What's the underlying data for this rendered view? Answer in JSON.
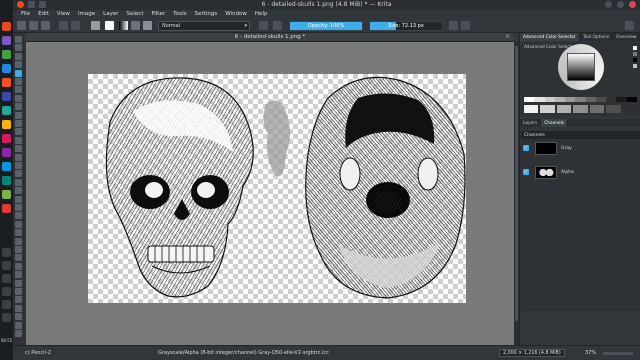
{
  "window": {
    "title": "6 - detailed-skulls 1.png (4.8 MiB) * — Krita",
    "icons": [
      "krita-logo-icon",
      "new-document-icon",
      "open-icon"
    ],
    "controls": [
      "minimize",
      "maximize",
      "close"
    ]
  },
  "menu": [
    "File",
    "Edit",
    "View",
    "Image",
    "Layer",
    "Select",
    "Filter",
    "Tools",
    "Settings",
    "Window",
    "Help"
  ],
  "toolbar": {
    "blend_mode": "Normal",
    "opacity_label": "Opacity: 100%",
    "opacity_fraction": 1.0,
    "size_label": "Size: 72.13 px",
    "size_fraction": 0.36
  },
  "dock": {
    "clock": "08:55",
    "icon_colors": [
      "#e64a19",
      "#7e57c2",
      "#43a047",
      "#1e88e5",
      "#f4511e",
      "#3949ab",
      "#26a69a",
      "#ffb300",
      "#d81b60",
      "#8e24aa",
      "#039be5",
      "#00897b",
      "#7cb342",
      "#e53935"
    ]
  },
  "document": {
    "tab_title": "6 - detailed-skulls 1.png *",
    "close_glyph": "×"
  },
  "dockers": {
    "top_tabs": [
      "Advanced Color Selector",
      "Tool Options",
      "Overview"
    ],
    "color_selector_title": "Advanced Color Selector",
    "mid_tabs": [
      "Layers",
      "Channels"
    ],
    "channels_title": "Channels",
    "channels": [
      {
        "name": "Gray",
        "checked": true
      },
      {
        "name": "Alpha",
        "checked": true
      }
    ],
    "check_glyph": "✓"
  },
  "status": {
    "brush": "c) Pencil-2",
    "image_info": "Grayscale/Alpha (8-bit integer/channel)  Gray-D50-elle-V2-srgbtrc.icc",
    "dimensions": "2,000 × 1,216 (4.8 MiB)",
    "zoom": "37%"
  }
}
